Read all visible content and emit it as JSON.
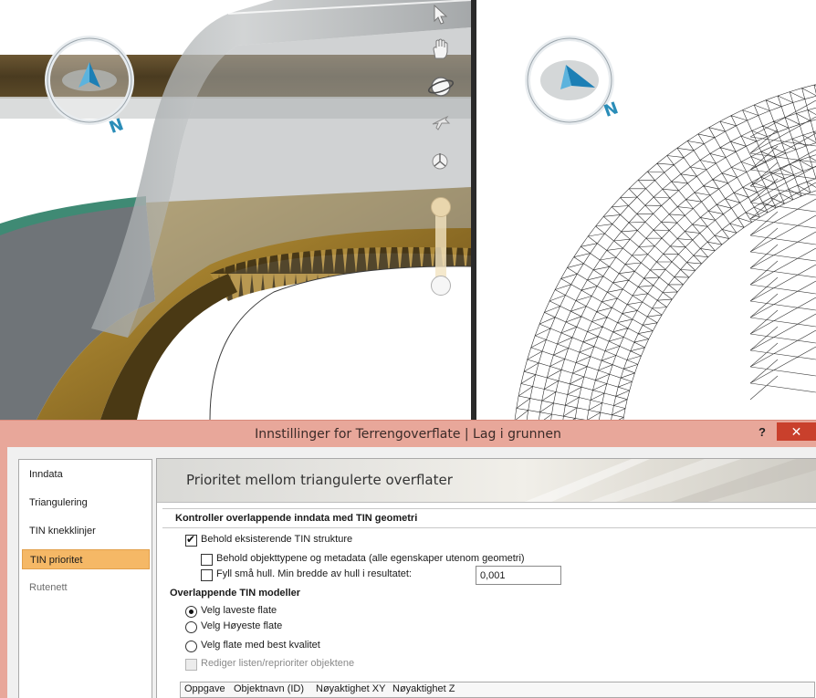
{
  "viewport": {
    "compass_left_label": "N",
    "compass_right_label": "N",
    "tools": [
      {
        "icon": "pointer-arrow-icon"
      },
      {
        "icon": "pan-hand-icon"
      },
      {
        "icon": "orbit-icon"
      },
      {
        "icon": "fly-icon"
      },
      {
        "icon": "walk-icon"
      }
    ]
  },
  "dialog": {
    "title": "Innstillinger for Terrengoverflate |  Lag i grunnen",
    "help_label": "?",
    "close_label": "✕",
    "nav_items": [
      {
        "label": "Inndata",
        "state": "normal"
      },
      {
        "label": "Triangulering",
        "state": "normal"
      },
      {
        "label": "TIN knekklinjer",
        "state": "normal"
      },
      {
        "label": "TIN prioritet",
        "state": "active"
      },
      {
        "label": "Rutenett",
        "state": "disabled"
      }
    ],
    "banner_title": "Prioritet mellom triangulerte overflater",
    "section1": {
      "header": "Kontroller overlappende inndata med TIN geometri",
      "keep_tin": {
        "label": "Behold eksisterende TIN strukture",
        "checked": true
      },
      "keep_types": {
        "label": "Behold objekttypene og metadata (alle egenskaper utenom geometri)",
        "checked": false
      },
      "fill_holes": {
        "label": "Fyll små hull. Min bredde av hull i resultatet:",
        "checked": false,
        "value": "0,001"
      }
    },
    "section2": {
      "header": "Overlappende TIN modeller",
      "options": [
        {
          "label": "Velg laveste flate",
          "checked": true
        },
        {
          "label": "Velg Høyeste flate",
          "checked": false
        },
        {
          "label": "Velg flate med best kvalitet",
          "checked": false
        }
      ],
      "edit_list": {
        "label": "Rediger listen/reprioriter objektene",
        "checked": false,
        "disabled": true
      }
    },
    "table": {
      "columns": [
        "Oppgave",
        "Objektnavn (ID)",
        "Nøyaktighet XY",
        "Nøyaktighet Z"
      ]
    }
  }
}
